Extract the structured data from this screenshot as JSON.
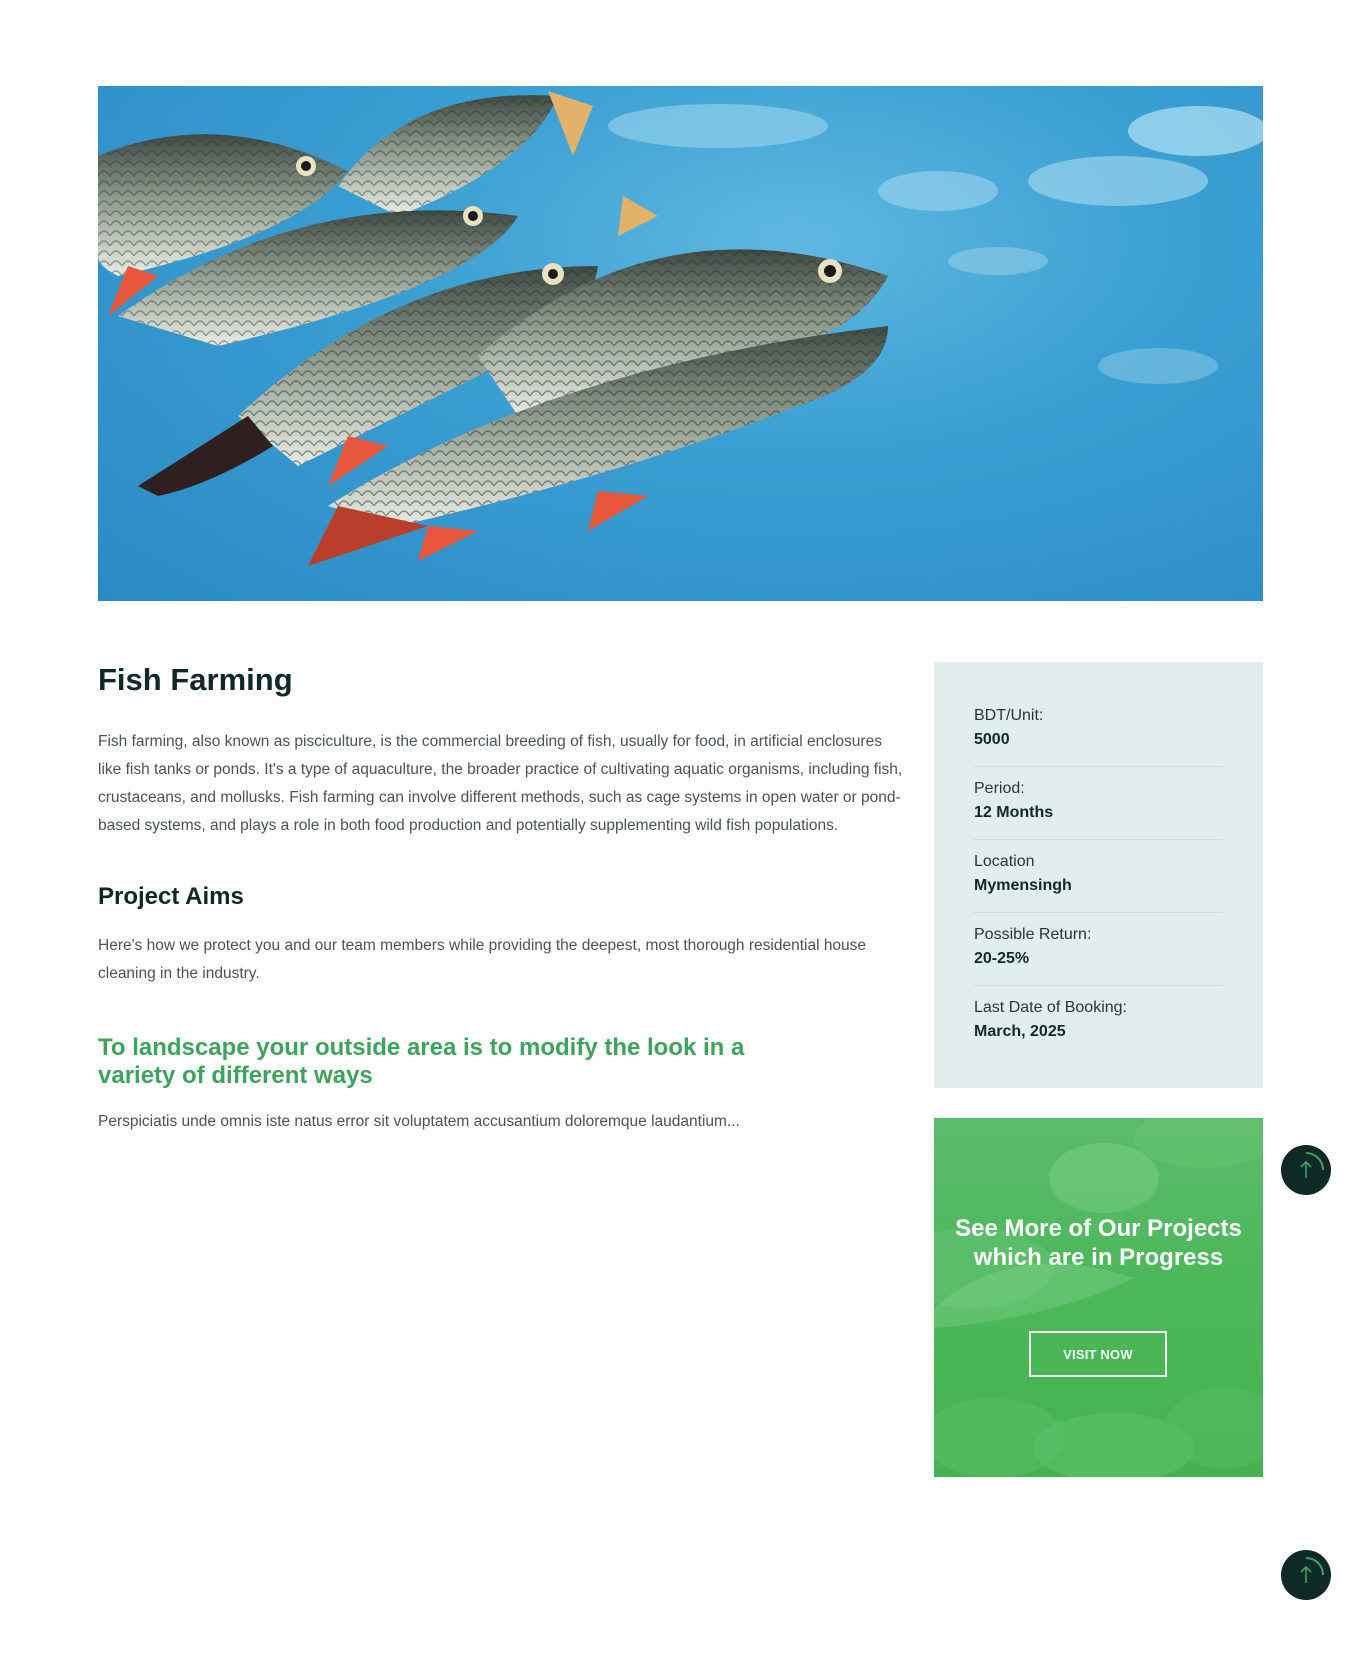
{
  "hero": {
    "image": "fish-school-photo"
  },
  "main": {
    "title": "Fish Farming",
    "intro": "Fish farming, also known as pisciculture, is the commercial breeding of fish, usually for food, in artificial enclosures like fish tanks or ponds. It's a type of aquaculture, the broader practice of cultivating aquatic organisms, including fish, crustaceans, and mollusks. Fish farming can involve different methods, such as cage systems in open water or pond-based systems, and plays a role in both food production and potentially supplementing wild fish populations.",
    "aims_title": "Project Aims",
    "aims_text": "Here's how we protect you and our team members while providing the deepest, most thorough residential house cleaning in the industry.",
    "highlight": "To landscape your outside area is to modify the look in a variety of different ways",
    "tail": "Perspiciatis unde omnis iste natus error sit voluptatem accusantium doloremque laudantium..."
  },
  "info": [
    {
      "label": "BDT/Unit:",
      "value": "5000"
    },
    {
      "label": "Period:",
      "value": "12 Months"
    },
    {
      "label": "Location",
      "value": "Mymensingh"
    },
    {
      "label": "Possible Return:",
      "value": "20-25%"
    },
    {
      "label": "Last Date of Booking:",
      "value": "March, 2025"
    }
  ],
  "promo": {
    "title": "See More of Our Projects which are in Progress",
    "button": "VISIT NOW"
  },
  "scroll_top": {
    "icon": "arrow-up-icon"
  },
  "colors": {
    "accent": "#3ea35c",
    "dark": "#0f2a26",
    "panel": "#e2eeee",
    "promo": "#4cb85a"
  }
}
